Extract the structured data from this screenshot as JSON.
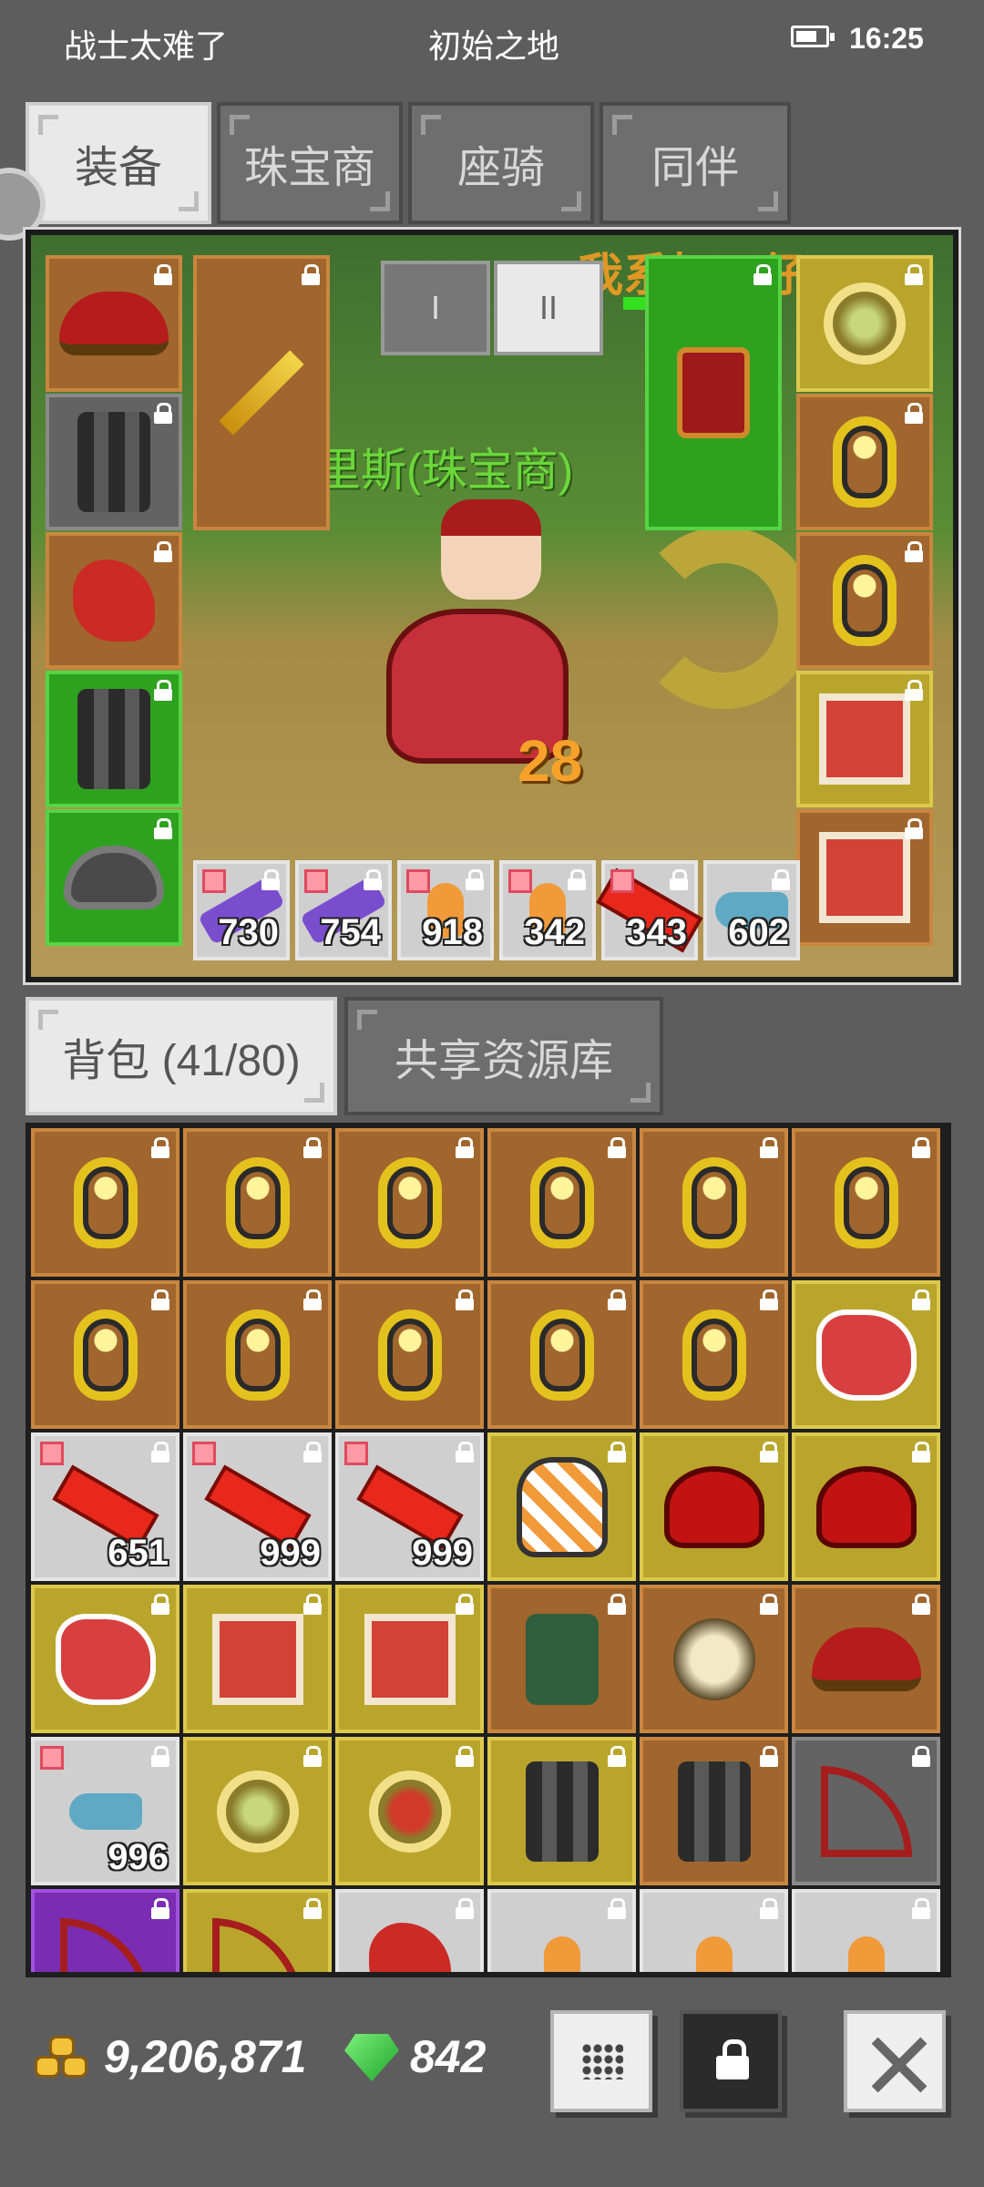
{
  "status": {
    "left": "战士太难了",
    "center": "初始之地",
    "time": "16:25"
  },
  "top_tabs": [
    "装备",
    "珠宝商",
    "座骑",
    "同伴"
  ],
  "scene": {
    "character_name": "克里斯(珠宝商)",
    "damage_number": "28",
    "overlay_text": "我系打工仔",
    "mode_tabs": [
      "I",
      "II"
    ]
  },
  "equip_left": [
    {
      "icon": "hat-icon",
      "color": "orange"
    },
    {
      "icon": "armor-icon",
      "color": "gray"
    },
    {
      "icon": "glove-icon",
      "color": "orange"
    },
    {
      "icon": "greaves-icon",
      "color": "green"
    },
    {
      "icon": "helm-icon",
      "color": "green"
    }
  ],
  "equip_right": [
    {
      "icon": "amulet-icon",
      "color": "yellow"
    },
    {
      "icon": "ring-icon",
      "color": "orange"
    },
    {
      "icon": "ring-icon",
      "color": "orange"
    },
    {
      "icon": "book-icon",
      "color": "yellow"
    },
    {
      "icon": "wings-icon",
      "color": "orange"
    }
  ],
  "quick_slots": [
    {
      "icon": "scroll-icon",
      "count": "730"
    },
    {
      "icon": "scroll-icon",
      "count": "754"
    },
    {
      "icon": "potion-icon",
      "count": "918"
    },
    {
      "icon": "potion-icon",
      "count": "342"
    },
    {
      "icon": "firework-icon",
      "count": "343"
    },
    {
      "icon": "fish-icon",
      "count": "602"
    }
  ],
  "bag_tabs": [
    "背包 (41/80)",
    "共享资源库"
  ],
  "bag": [
    {
      "icon": "ring-icon",
      "color": "orange"
    },
    {
      "icon": "ring-icon",
      "color": "orange"
    },
    {
      "icon": "ring-icon",
      "color": "orange"
    },
    {
      "icon": "ring-icon",
      "color": "orange"
    },
    {
      "icon": "ring-icon",
      "color": "orange"
    },
    {
      "icon": "ring-icon",
      "color": "orange"
    },
    {
      "icon": "ring-icon",
      "color": "orange"
    },
    {
      "icon": "ring-icon",
      "color": "orange"
    },
    {
      "icon": "ring-icon",
      "color": "orange"
    },
    {
      "icon": "ring-icon",
      "color": "orange"
    },
    {
      "icon": "ring-icon",
      "color": "orange"
    },
    {
      "icon": "dragon-icon",
      "color": "yellow"
    },
    {
      "icon": "redbar-icon",
      "color": "lightgray",
      "count": "651"
    },
    {
      "icon": "redbar-icon",
      "color": "lightgray",
      "count": "999"
    },
    {
      "icon": "redbar-icon",
      "color": "lightgray",
      "count": "999"
    },
    {
      "icon": "tiger-icon",
      "color": "yellow"
    },
    {
      "icon": "redhelm-icon",
      "color": "yellow"
    },
    {
      "icon": "redhelm-icon",
      "color": "yellow"
    },
    {
      "icon": "dragon-icon",
      "color": "yellow"
    },
    {
      "icon": "book-icon",
      "color": "yellow"
    },
    {
      "icon": "book-icon",
      "color": "yellow"
    },
    {
      "icon": "vest-icon",
      "color": "orange"
    },
    {
      "icon": "morningstar-icon",
      "color": "orange"
    },
    {
      "icon": "hat-icon",
      "color": "orange"
    },
    {
      "icon": "fish-icon",
      "color": "lightgray",
      "count": "996"
    },
    {
      "icon": "amulet-icon",
      "color": "yellow"
    },
    {
      "icon": "amulet-red-icon",
      "color": "yellow"
    },
    {
      "icon": "greaves-icon",
      "color": "yellow"
    },
    {
      "icon": "greaves-icon",
      "color": "orange"
    },
    {
      "icon": "bow-icon",
      "color": "gray"
    },
    {
      "icon": "bow-icon",
      "color": "purple"
    },
    {
      "icon": "bow-icon",
      "color": "yellow"
    },
    {
      "icon": "frog-icon",
      "color": "lightgray"
    },
    {
      "icon": "potion-icon",
      "color": "lightgray"
    },
    {
      "icon": "potion-icon",
      "color": "lightgray"
    },
    {
      "icon": "potion-icon",
      "color": "lightgray"
    }
  ],
  "currency": {
    "gold": "9,206,871",
    "gems": "842"
  }
}
